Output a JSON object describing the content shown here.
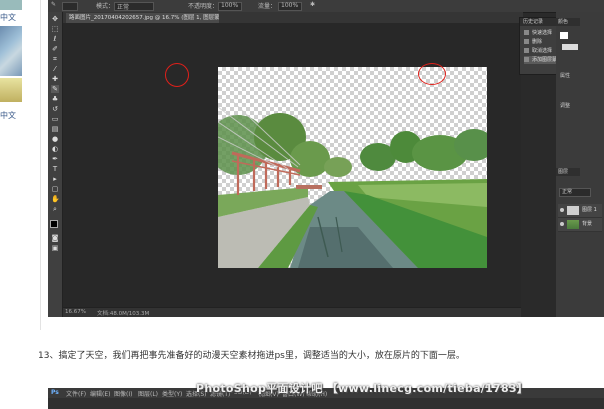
{
  "left_strip": {
    "items": [
      "中文",
      "中文"
    ]
  },
  "options_bar": {
    "mode_label": "模式：",
    "mode_value": "正常",
    "opacity_label": "不透明度：",
    "opacity_value": "100%",
    "flow_label": "流量：",
    "flow_value": "100%"
  },
  "document": {
    "tab_title": "路面图片_20170404202657.jpg @ 16.7% (图层 1, 图层蒙版/8) *",
    "zoom": "16.67%",
    "doc_size": "文档:48.0M/103.3M"
  },
  "history_panel": {
    "title": "历史记录",
    "items": [
      "快速选择",
      "删除",
      "取消选择",
      "添加图层蒙版"
    ]
  },
  "right_panel": {
    "tab1": "颜色",
    "tab2": "图层",
    "label_adjust": "调整",
    "label_properties": "属性",
    "layer_mode": "正常",
    "layers": [
      {
        "name": "图层 1"
      },
      {
        "name": "背景"
      }
    ]
  },
  "caption": "13、搞定了天空，我们再把事先准备好的动漫天空素材拖进ps里，调整适当的大小，放在原片的下面一层。",
  "watermark": "PhotoShop平面设计吧 【www.linecg.com/tieba/1783】",
  "second_window": {
    "menu": [
      "Ps",
      "文件(F)",
      "编辑(E)",
      "图像(I)",
      "图层(L)",
      "类型(Y)",
      "选择(S)",
      "滤镜(T)",
      "3D(D)",
      "视图(V)",
      "窗口(W)",
      "帮助(H)"
    ]
  },
  "colors": {
    "ps_bg": "#282828",
    "highlight_circle": "#e0201a",
    "caption_text": "#333333"
  }
}
